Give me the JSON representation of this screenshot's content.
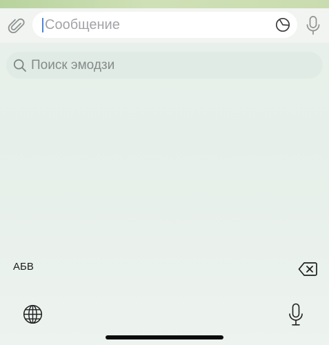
{
  "composer": {
    "placeholder": "Сообщение",
    "icons": {
      "attach": "paperclip-icon",
      "sticker": "sticker-icon",
      "voice": "microphone-icon"
    }
  },
  "emoji_search": {
    "placeholder": "Поиск эмодзи",
    "icon": "search-icon"
  },
  "keyboard": {
    "abc_label": "АБВ",
    "icons": {
      "delete": "backspace-icon",
      "language": "globe-icon",
      "dictation": "microphone-icon"
    }
  },
  "colors": {
    "caret": "#4a86d6",
    "background": "#e6efe9",
    "field": "#ffffff",
    "search_field": "#e1ebe6"
  }
}
